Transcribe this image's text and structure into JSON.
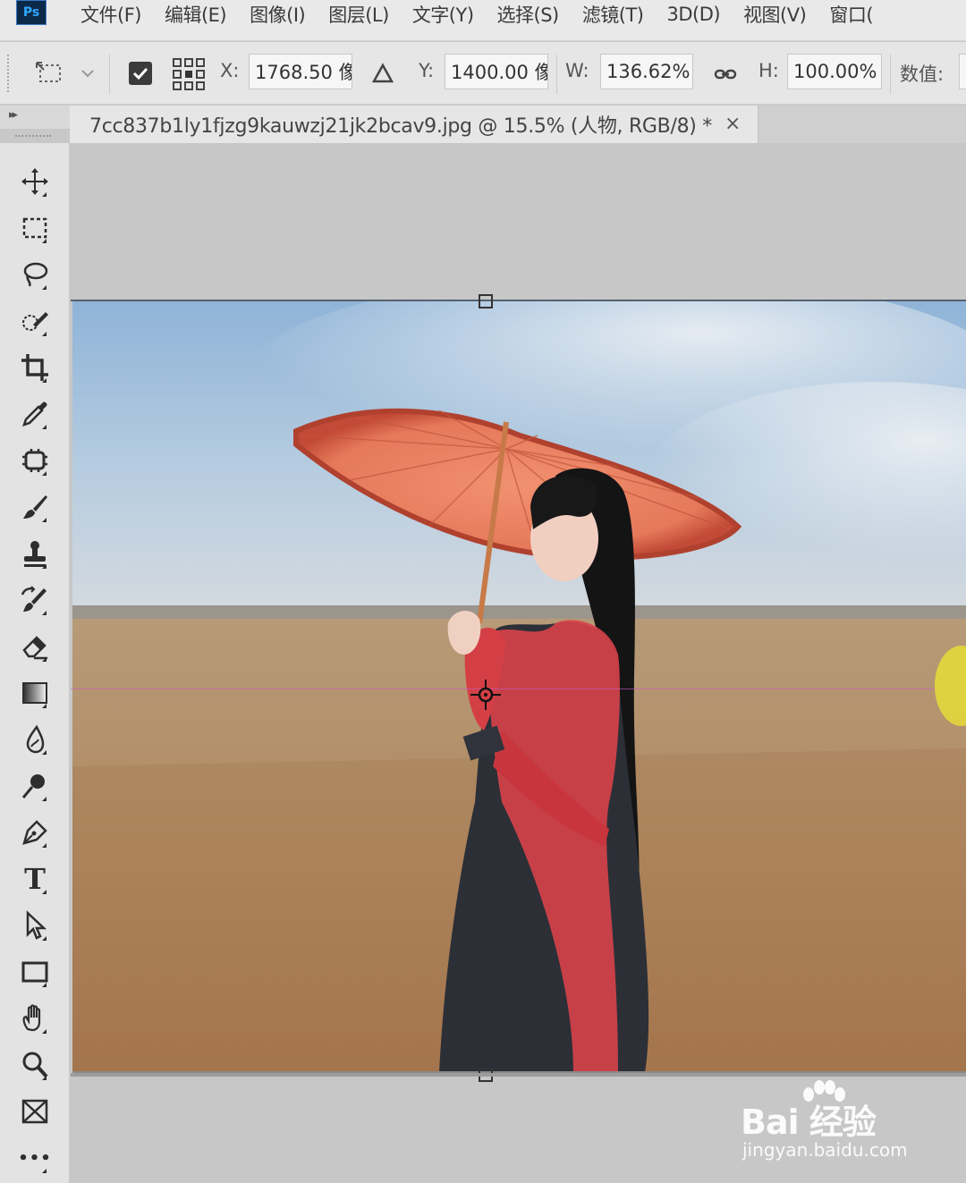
{
  "app": {
    "logo_text": "Ps"
  },
  "menubar": {
    "items": [
      "文件(F)",
      "编辑(E)",
      "图像(I)",
      "图层(L)",
      "文字(Y)",
      "选择(S)",
      "滤镜(T)",
      "3D(D)",
      "视图(V)",
      "窗口("
    ]
  },
  "options": {
    "x_label": "X:",
    "x_value": "1768.50 像",
    "y_label": "Y:",
    "y_value": "1400.00 像",
    "w_label": "W:",
    "w_value": "136.62%",
    "h_label": "H:",
    "h_value": "100.00%",
    "interp_label": "数值:",
    "reference_checked": true
  },
  "document": {
    "tab_title": "7cc837b1ly1fjzg9kauwzj21jk2bcav9.jpg @ 15.5% (人物, RGB/8) *",
    "close_glyph": "×"
  },
  "tools": [
    "move-tool",
    "rectangular-marquee-tool",
    "lasso-tool",
    "quick-selection-tool",
    "crop-tool",
    "eyedropper-tool",
    "patch-tool",
    "brush-tool",
    "clone-stamp-tool",
    "history-brush-tool",
    "eraser-tool",
    "gradient-tool",
    "blur-tool",
    "dodge-tool",
    "pen-tool",
    "type-tool",
    "path-selection-tool",
    "rectangle-tool",
    "hand-tool",
    "zoom-tool",
    "frame-tool",
    "more-tools"
  ],
  "toolbar": {
    "type_glyph": "T",
    "more_glyph": "•••",
    "collapse_glyph": "▸▸"
  },
  "watermark": {
    "main": "Bai 经验",
    "sub": "jingyan.baidu.com"
  },
  "colors": {
    "accent": "#31a8ff",
    "guide": "#c85ac8",
    "ui_bg": "#e6e6e6"
  }
}
